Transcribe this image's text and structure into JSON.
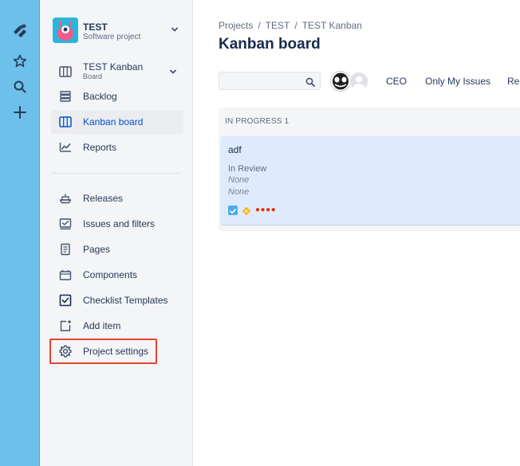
{
  "project": {
    "name": "TEST",
    "type": "Software project"
  },
  "board_selector": {
    "name": "TEST Kanban",
    "type": "Board"
  },
  "sidebar": {
    "top_items": [
      {
        "label": "Backlog",
        "icon": "backlog-icon"
      },
      {
        "label": "Kanban board",
        "icon": "board-icon",
        "active": true
      },
      {
        "label": "Reports",
        "icon": "reports-icon"
      }
    ],
    "bottom_items": [
      {
        "label": "Releases",
        "icon": "ship-icon"
      },
      {
        "label": "Issues and filters",
        "icon": "issues-icon"
      },
      {
        "label": "Pages",
        "icon": "page-icon"
      },
      {
        "label": "Components",
        "icon": "component-icon"
      },
      {
        "label": "Checklist Templates",
        "icon": "checkbox-icon"
      },
      {
        "label": "Add item",
        "icon": "add-item-icon"
      },
      {
        "label": "Project settings",
        "icon": "gear-icon",
        "highlighted": true
      }
    ]
  },
  "breadcrumbs": [
    "Projects",
    "TEST",
    "TEST Kanban"
  ],
  "page_title": "Kanban board",
  "search": {
    "value": "",
    "placeholder": ""
  },
  "quick_filters": [
    "CEO",
    "Only My Issues",
    "Rec"
  ],
  "columns": [
    {
      "header": "IN PROGRESS 1",
      "cards": [
        {
          "summary": "adf",
          "status": "In Review",
          "field1": "None",
          "field2": "None",
          "dots": "●●●●"
        }
      ]
    }
  ],
  "colors": {
    "rail": "#6cc0ea",
    "sidebar": "#f4f5f7",
    "card": "#deebff",
    "highlight": "#e3432f",
    "link": "#0052cc"
  }
}
